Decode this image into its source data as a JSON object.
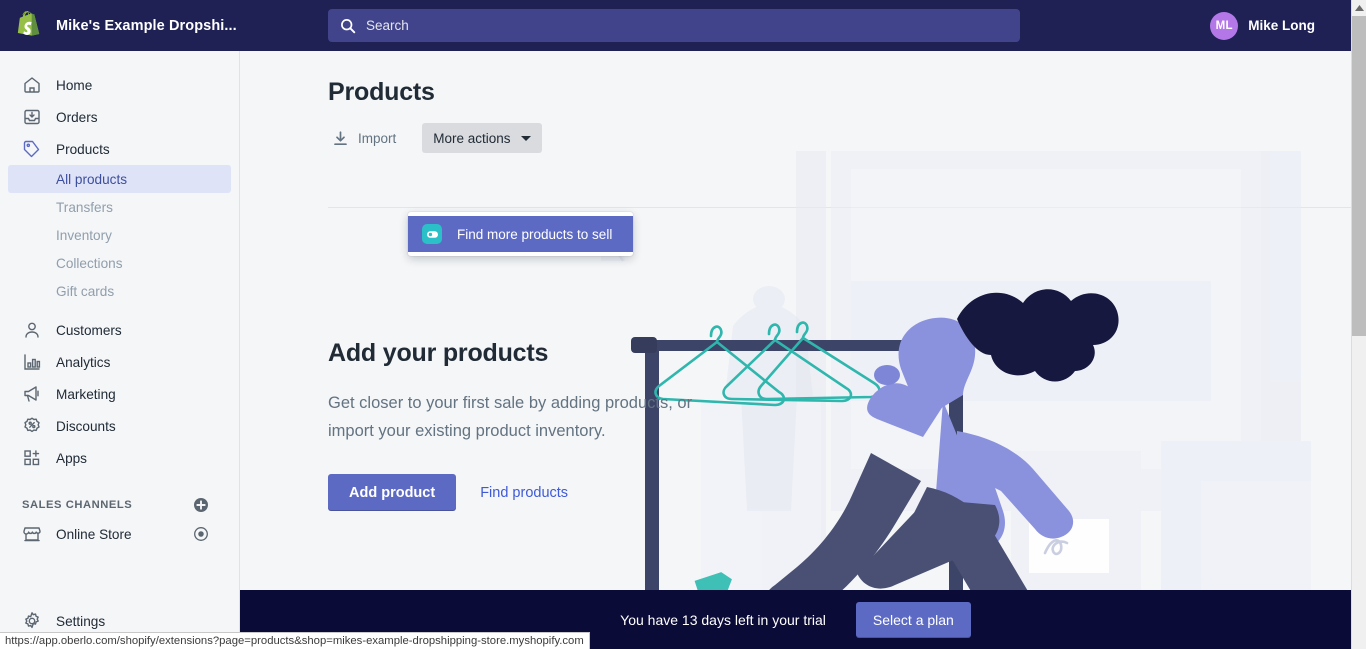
{
  "topbar": {
    "store_name": "Mike's Example Dropshi...",
    "logo_icon": "shopify-bag-icon",
    "search": {
      "placeholder": "Search",
      "icon": "search-icon"
    },
    "user": {
      "initials": "ML",
      "name": "Mike Long"
    }
  },
  "sidebar": {
    "items": [
      {
        "label": "Home",
        "icon": "home-icon"
      },
      {
        "label": "Orders",
        "icon": "orders-inbox-icon"
      },
      {
        "label": "Products",
        "icon": "product-tag-icon"
      }
    ],
    "product_subitems": [
      {
        "label": "All products",
        "active": true
      },
      {
        "label": "Transfers",
        "active": false
      },
      {
        "label": "Inventory",
        "active": false
      },
      {
        "label": "Collections",
        "active": false
      },
      {
        "label": "Gift cards",
        "active": false
      }
    ],
    "items_after": [
      {
        "label": "Customers",
        "icon": "customer-person-icon"
      },
      {
        "label": "Analytics",
        "icon": "analytics-bar-chart-icon"
      },
      {
        "label": "Marketing",
        "icon": "marketing-megaphone-icon"
      },
      {
        "label": "Discounts",
        "icon": "discount-percent-icon"
      },
      {
        "label": "Apps",
        "icon": "apps-grid-plus-icon"
      }
    ],
    "sales_channels": {
      "heading": "SALES CHANNELS",
      "add_icon": "plus-circle-icon",
      "items": [
        {
          "label": "Online Store",
          "icon": "storefront-icon",
          "trailing_icon": "eye-icon"
        }
      ]
    },
    "settings": {
      "label": "Settings",
      "icon": "gear-icon"
    }
  },
  "main": {
    "page_title": "Products",
    "import_label": "Import",
    "import_icon": "download-arrow-icon",
    "more_actions_label": "More actions",
    "dropdown": {
      "items": [
        {
          "label": "Find more products to sell",
          "icon": "oberlo-icon",
          "highlighted": true
        }
      ]
    },
    "empty_state": {
      "heading": "Add your products",
      "body": "Get closer to your first sale by adding products, or import your existing product inventory.",
      "primary_button": "Add product",
      "secondary_link": "Find products",
      "illustration": "woman-with-clothing-rack-illustration"
    }
  },
  "trial_banner": {
    "message": "You have 13 days left in your trial",
    "button_label": "Select a plan"
  },
  "status_bar": {
    "url": "https://app.oberlo.com/shopify/extensions?page=products&shop=mikes-example-dropshipping-store.myshopify.com"
  },
  "colors": {
    "topbar": "#1f2155",
    "accent_indigo": "#5c6ac4",
    "link": "#3f5ad6",
    "avatar": "#b377e8",
    "oberlo_teal": "#2bbfc7",
    "banner_navy": "#0b0b38",
    "active_nav_bg": "#dfe3f7"
  }
}
